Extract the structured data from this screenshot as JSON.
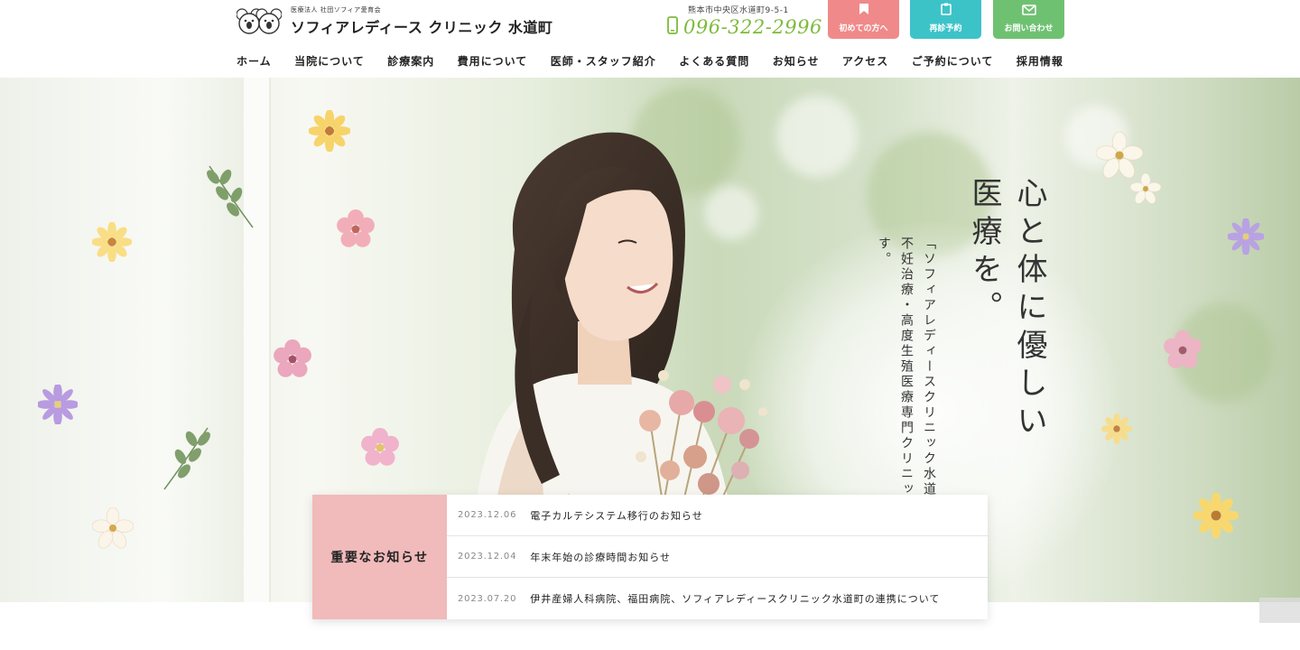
{
  "header": {
    "logo_sub": "医療法人 社団ソフィア愛育会",
    "logo_name": "ソフィアレディース クリニック 水道町",
    "address": "熊本市中央区水道町9-5-1",
    "phone": "096-322-2996",
    "buttons": [
      {
        "label": "初めての方へ",
        "icon": "bookmark-icon",
        "color": "#f08a8a"
      },
      {
        "label": "再診予約",
        "icon": "clipboard-icon",
        "color": "#3cc3c8"
      },
      {
        "label": "お問い合わせ",
        "icon": "mail-icon",
        "color": "#6fc172"
      }
    ]
  },
  "nav": {
    "items": [
      "ホーム",
      "当院について",
      "診療案内",
      "費用について",
      "医師・スタッフ紹介",
      "よくある質問",
      "お知らせ",
      "アクセス",
      "ご予約について",
      "採用情報"
    ]
  },
  "hero": {
    "tagline_main": "心と体に優しい医療を。",
    "tagline_sub": "「ソフィアレディースクリニック水道町」は 不妊治療・高度生殖医療専門クリニックです。"
  },
  "notice": {
    "title": "重要なお知らせ",
    "items": [
      {
        "date": "2023.12.06",
        "text": "電子カルテシステム移行のお知らせ"
      },
      {
        "date": "2023.12.04",
        "text": "年末年始の診療時間お知らせ"
      },
      {
        "date": "2023.07.20",
        "text": "伊井産婦人科病院、福田病院、ソフィアレディースクリニック水道町の連携について"
      }
    ]
  },
  "colors": {
    "phone": "#7dbb3b",
    "notice_head": "#f1babb",
    "btn_first": "#f08a8a",
    "btn_revisit": "#3cc3c8",
    "btn_contact": "#6fc172"
  }
}
